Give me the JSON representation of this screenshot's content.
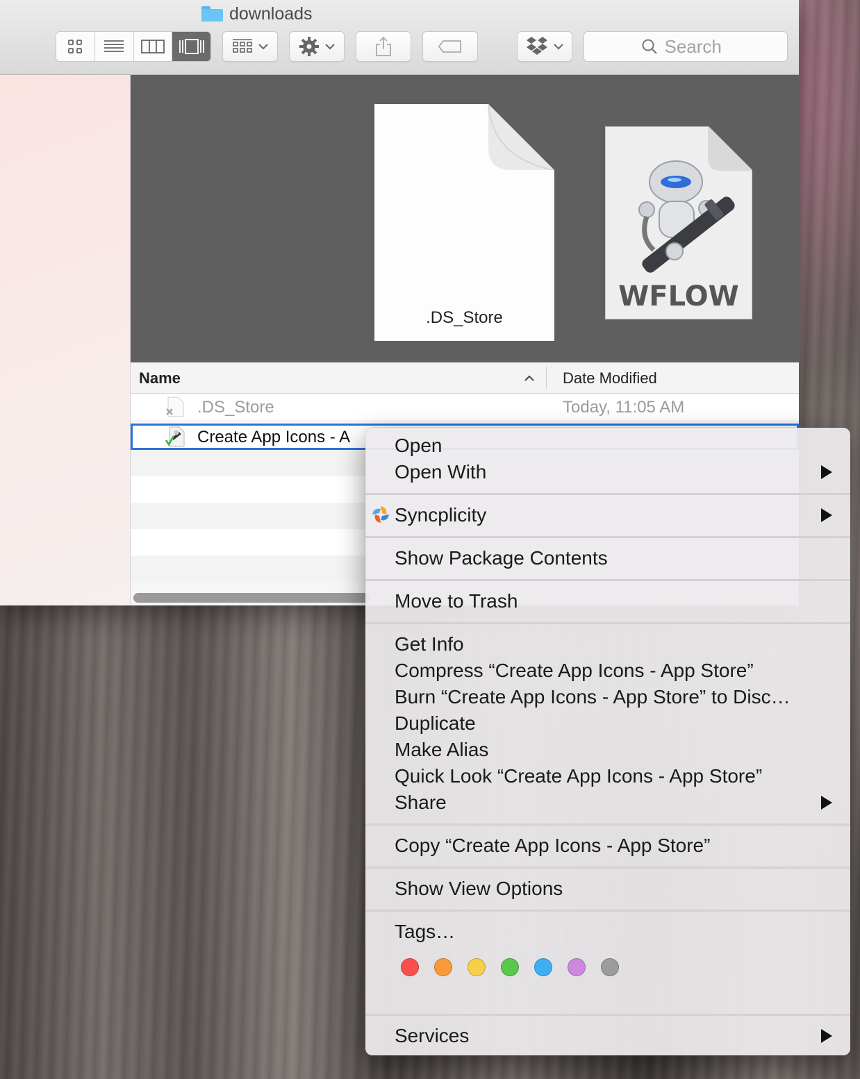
{
  "window": {
    "title": "downloads",
    "search_placeholder": "Search"
  },
  "preview": {
    "doc_label": ".DS_Store",
    "wflow_label": "WFLOW"
  },
  "list": {
    "columns": {
      "name": "Name",
      "date": "Date Modified"
    },
    "rows": [
      {
        "name": ".DS_Store",
        "date": "Today, 11:05 AM"
      },
      {
        "name": "Create App Icons - A"
      }
    ]
  },
  "menu": {
    "items": {
      "open": "Open",
      "open_with": "Open With",
      "syncplicity": "Syncplicity",
      "show_package": "Show Package Contents",
      "move_trash": "Move to Trash",
      "get_info": "Get Info",
      "compress": "Compress “Create App Icons - App Store”",
      "burn": "Burn “Create App Icons - App Store” to Disc…",
      "duplicate": "Duplicate",
      "make_alias": "Make Alias",
      "quick_look": "Quick Look “Create App Icons - App Store”",
      "share": "Share",
      "copy": "Copy “Create App Icons - App Store”",
      "show_view_options": "Show View Options",
      "tags": "Tags…",
      "services": "Services"
    },
    "tag_colors": [
      "#fb4f4f",
      "#f89a3c",
      "#f8d047",
      "#5ac84c",
      "#3eaff3",
      "#cf87e0",
      "#9c9c9c"
    ]
  },
  "icons": [
    "folder-icon",
    "icon-view-icon",
    "list-view-icon",
    "column-view-icon",
    "cover-flow-icon",
    "arrange-icon",
    "gear-icon",
    "share-icon",
    "tag-icon",
    "dropbox-icon",
    "search-icon",
    "document-icon",
    "automator-icon",
    "syncplicity-icon"
  ]
}
